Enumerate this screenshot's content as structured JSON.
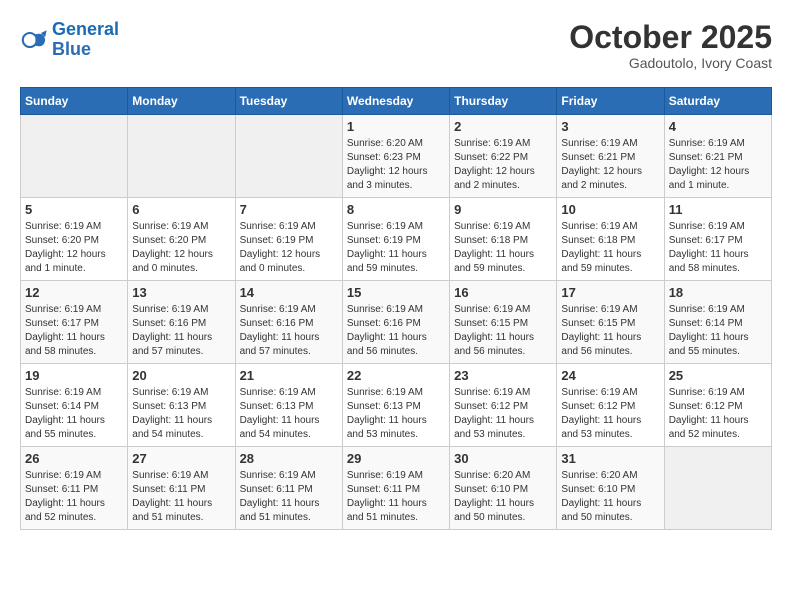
{
  "logo": {
    "line1": "General",
    "line2": "Blue"
  },
  "title": "October 2025",
  "subtitle": "Gadoutolo, Ivory Coast",
  "weekdays": [
    "Sunday",
    "Monday",
    "Tuesday",
    "Wednesday",
    "Thursday",
    "Friday",
    "Saturday"
  ],
  "weeks": [
    [
      {
        "day": "",
        "info": ""
      },
      {
        "day": "",
        "info": ""
      },
      {
        "day": "",
        "info": ""
      },
      {
        "day": "1",
        "info": "Sunrise: 6:20 AM\nSunset: 6:23 PM\nDaylight: 12 hours and 3 minutes."
      },
      {
        "day": "2",
        "info": "Sunrise: 6:19 AM\nSunset: 6:22 PM\nDaylight: 12 hours and 2 minutes."
      },
      {
        "day": "3",
        "info": "Sunrise: 6:19 AM\nSunset: 6:21 PM\nDaylight: 12 hours and 2 minutes."
      },
      {
        "day": "4",
        "info": "Sunrise: 6:19 AM\nSunset: 6:21 PM\nDaylight: 12 hours and 1 minute."
      }
    ],
    [
      {
        "day": "5",
        "info": "Sunrise: 6:19 AM\nSunset: 6:20 PM\nDaylight: 12 hours and 1 minute."
      },
      {
        "day": "6",
        "info": "Sunrise: 6:19 AM\nSunset: 6:20 PM\nDaylight: 12 hours and 0 minutes."
      },
      {
        "day": "7",
        "info": "Sunrise: 6:19 AM\nSunset: 6:19 PM\nDaylight: 12 hours and 0 minutes."
      },
      {
        "day": "8",
        "info": "Sunrise: 6:19 AM\nSunset: 6:19 PM\nDaylight: 11 hours and 59 minutes."
      },
      {
        "day": "9",
        "info": "Sunrise: 6:19 AM\nSunset: 6:18 PM\nDaylight: 11 hours and 59 minutes."
      },
      {
        "day": "10",
        "info": "Sunrise: 6:19 AM\nSunset: 6:18 PM\nDaylight: 11 hours and 59 minutes."
      },
      {
        "day": "11",
        "info": "Sunrise: 6:19 AM\nSunset: 6:17 PM\nDaylight: 11 hours and 58 minutes."
      }
    ],
    [
      {
        "day": "12",
        "info": "Sunrise: 6:19 AM\nSunset: 6:17 PM\nDaylight: 11 hours and 58 minutes."
      },
      {
        "day": "13",
        "info": "Sunrise: 6:19 AM\nSunset: 6:16 PM\nDaylight: 11 hours and 57 minutes."
      },
      {
        "day": "14",
        "info": "Sunrise: 6:19 AM\nSunset: 6:16 PM\nDaylight: 11 hours and 57 minutes."
      },
      {
        "day": "15",
        "info": "Sunrise: 6:19 AM\nSunset: 6:16 PM\nDaylight: 11 hours and 56 minutes."
      },
      {
        "day": "16",
        "info": "Sunrise: 6:19 AM\nSunset: 6:15 PM\nDaylight: 11 hours and 56 minutes."
      },
      {
        "day": "17",
        "info": "Sunrise: 6:19 AM\nSunset: 6:15 PM\nDaylight: 11 hours and 56 minutes."
      },
      {
        "day": "18",
        "info": "Sunrise: 6:19 AM\nSunset: 6:14 PM\nDaylight: 11 hours and 55 minutes."
      }
    ],
    [
      {
        "day": "19",
        "info": "Sunrise: 6:19 AM\nSunset: 6:14 PM\nDaylight: 11 hours and 55 minutes."
      },
      {
        "day": "20",
        "info": "Sunrise: 6:19 AM\nSunset: 6:13 PM\nDaylight: 11 hours and 54 minutes."
      },
      {
        "day": "21",
        "info": "Sunrise: 6:19 AM\nSunset: 6:13 PM\nDaylight: 11 hours and 54 minutes."
      },
      {
        "day": "22",
        "info": "Sunrise: 6:19 AM\nSunset: 6:13 PM\nDaylight: 11 hours and 53 minutes."
      },
      {
        "day": "23",
        "info": "Sunrise: 6:19 AM\nSunset: 6:12 PM\nDaylight: 11 hours and 53 minutes."
      },
      {
        "day": "24",
        "info": "Sunrise: 6:19 AM\nSunset: 6:12 PM\nDaylight: 11 hours and 53 minutes."
      },
      {
        "day": "25",
        "info": "Sunrise: 6:19 AM\nSunset: 6:12 PM\nDaylight: 11 hours and 52 minutes."
      }
    ],
    [
      {
        "day": "26",
        "info": "Sunrise: 6:19 AM\nSunset: 6:11 PM\nDaylight: 11 hours and 52 minutes."
      },
      {
        "day": "27",
        "info": "Sunrise: 6:19 AM\nSunset: 6:11 PM\nDaylight: 11 hours and 51 minutes."
      },
      {
        "day": "28",
        "info": "Sunrise: 6:19 AM\nSunset: 6:11 PM\nDaylight: 11 hours and 51 minutes."
      },
      {
        "day": "29",
        "info": "Sunrise: 6:19 AM\nSunset: 6:11 PM\nDaylight: 11 hours and 51 minutes."
      },
      {
        "day": "30",
        "info": "Sunrise: 6:20 AM\nSunset: 6:10 PM\nDaylight: 11 hours and 50 minutes."
      },
      {
        "day": "31",
        "info": "Sunrise: 6:20 AM\nSunset: 6:10 PM\nDaylight: 11 hours and 50 minutes."
      },
      {
        "day": "",
        "info": ""
      }
    ]
  ]
}
